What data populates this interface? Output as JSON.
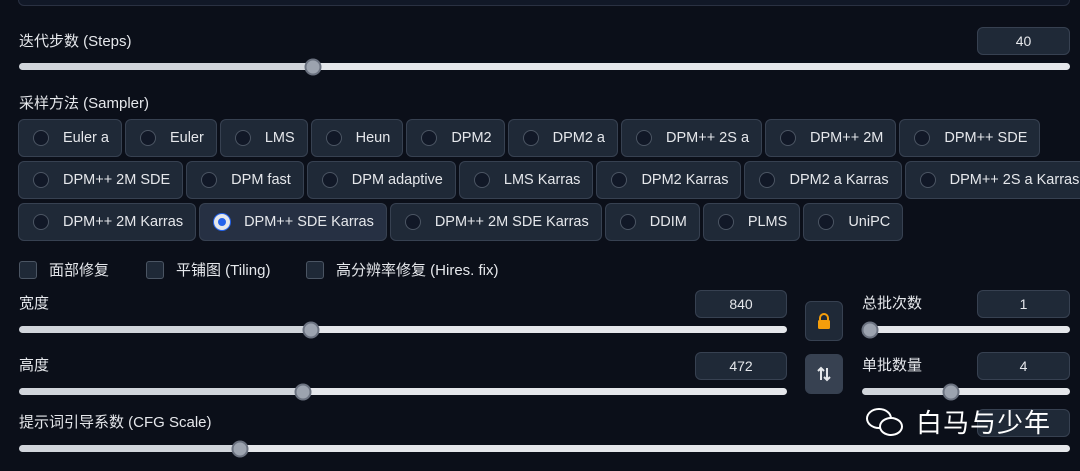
{
  "steps": {
    "label": "迭代步数 (Steps)",
    "value": "40",
    "fraction": 0.28
  },
  "sampler": {
    "label": "采样方法 (Sampler)",
    "rows": [
      [
        "Euler a",
        "Euler",
        "LMS",
        "Heun",
        "DPM2",
        "DPM2 a",
        "DPM++ 2S a",
        "DPM++ 2M",
        "DPM++ SDE"
      ],
      [
        "DPM++ 2M SDE",
        "DPM fast",
        "DPM adaptive",
        "LMS Karras",
        "DPM2 Karras",
        "DPM2 a Karras",
        "DPM++ 2S a Karras"
      ],
      [
        "DPM++ 2M Karras",
        "DPM++ SDE Karras",
        "DPM++ 2M SDE Karras",
        "DDIM",
        "PLMS",
        "UniPC"
      ]
    ],
    "selected": "DPM++ SDE Karras"
  },
  "options": {
    "face_restore": "面部修复",
    "tiling": "平铺图 (Tiling)",
    "hires_fix": "高分辨率修复 (Hires. fix)"
  },
  "width": {
    "label": "宽度",
    "value": "840",
    "fraction": 0.38
  },
  "height": {
    "label": "高度",
    "value": "472",
    "fraction": 0.37
  },
  "batch_count": {
    "label": "总批次数",
    "value": "1",
    "fraction": 0.04
  },
  "batch_size": {
    "label": "单批数量",
    "value": "4",
    "fraction": 0.43
  },
  "cfg": {
    "label": "提示词引导系数 (CFG Scale)",
    "fraction": 0.21
  },
  "watermark": {
    "text": "白马与少年"
  },
  "icons": {
    "lock": "lock-icon",
    "swap": "swap-icon",
    "wechat": "wechat-icon"
  },
  "colors": {
    "background": "#0b0f19",
    "accent": "#2563eb",
    "lock": "#f59e0b"
  }
}
